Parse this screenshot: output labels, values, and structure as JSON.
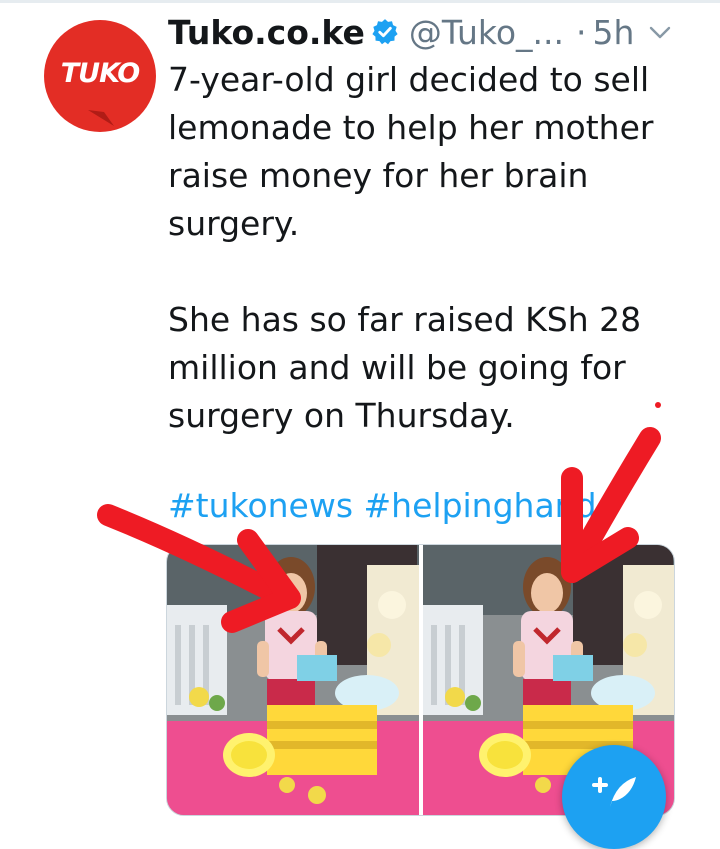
{
  "account": {
    "name": "Tuko.co.ke",
    "handle": "@Tuko_...",
    "separator": "·",
    "time": "5h",
    "avatar_text": "TUKO"
  },
  "tweet": {
    "text": "7-year-old girl decided to sell\nlemonade to help her mother\nraise money for her brain\nsurgery.\n\nShe has so far raised KSh 28\nmillion and will be going for\nsurgery on Thursday.",
    "hashtags": [
      "#tukonews",
      "#helpinghand"
    ]
  },
  "media": {
    "photos": [
      "photo-left",
      "photo-right"
    ]
  },
  "icons": [
    "verified-badge-icon",
    "chevron-down-icon",
    "compose-tweet-icon"
  ],
  "colors": {
    "accent": "#1da1f2",
    "brand": "#e32d25",
    "annotation_arrow": "#ee1b24",
    "text": "#14171a",
    "muted": "#657786"
  }
}
